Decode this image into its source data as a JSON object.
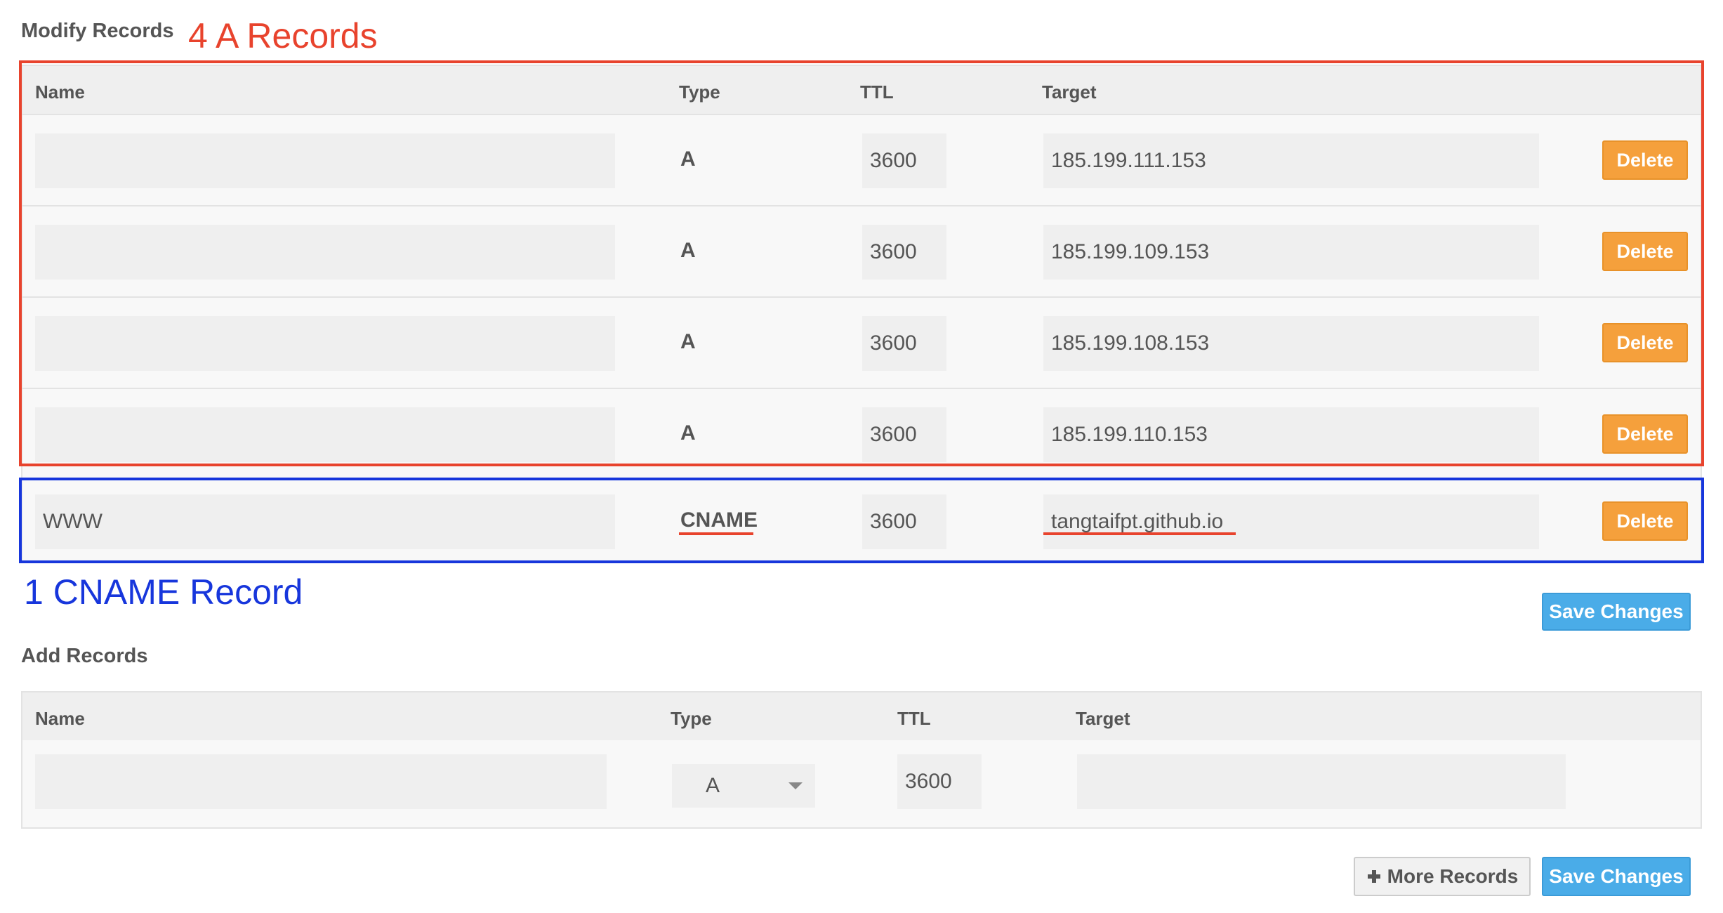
{
  "modify": {
    "heading": "Modify Records",
    "annotation_a": "4 A Records",
    "annotation_cname": "1 CNAME Record",
    "columns": {
      "name": "Name",
      "type": "Type",
      "ttl": "TTL",
      "target": "Target"
    },
    "rows": [
      {
        "name": "",
        "type": "A",
        "ttl": "3600",
        "target": "185.199.111.153",
        "delete": "Delete"
      },
      {
        "name": "",
        "type": "A",
        "ttl": "3600",
        "target": "185.199.109.153",
        "delete": "Delete"
      },
      {
        "name": "",
        "type": "A",
        "ttl": "3600",
        "target": "185.199.108.153",
        "delete": "Delete"
      },
      {
        "name": "",
        "type": "A",
        "ttl": "3600",
        "target": "185.199.110.153",
        "delete": "Delete"
      },
      {
        "name": "WWW",
        "type": "CNAME",
        "ttl": "3600",
        "target": "tangtaifpt.github.io",
        "delete": "Delete"
      }
    ],
    "save_label": "Save Changes"
  },
  "add": {
    "heading": "Add Records",
    "columns": {
      "name": "Name",
      "type": "Type",
      "ttl": "TTL",
      "target": "Target"
    },
    "row": {
      "name": "",
      "type": "A",
      "ttl": "3600",
      "target": ""
    },
    "more_label": "More Records",
    "save_label": "Save Changes"
  },
  "colors": {
    "annotation_red": "#e8432d",
    "annotation_blue": "#1736dc",
    "delete_orange": "#f5a03c",
    "save_blue": "#4aace8"
  },
  "icons": {
    "more_records": "plus-icon",
    "type_dropdown": "chevron-down-icon"
  }
}
